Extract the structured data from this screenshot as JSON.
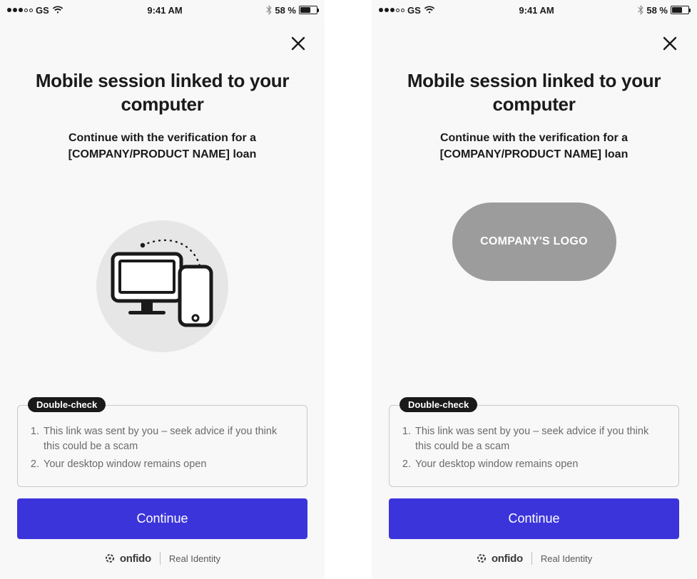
{
  "statusbar": {
    "carrier": "GS",
    "time": "9:41 AM",
    "battery_pct": "58 %",
    "battery_fill_pct": 58
  },
  "header": {
    "title": "Mobile session linked to your computer",
    "subtitle": "Continue with the verification for a [COMPANY/PRODUCT NAME] loan"
  },
  "logo_placeholder": "COMPANY'S LOGO",
  "double_check": {
    "badge": "Double-check",
    "items": [
      "This link was sent by you – seek advice if you think this could be a scam",
      "Your desktop window remains open"
    ]
  },
  "actions": {
    "continue_label": "Continue"
  },
  "footer": {
    "brand": "onfido",
    "tagline": "Real Identity"
  }
}
